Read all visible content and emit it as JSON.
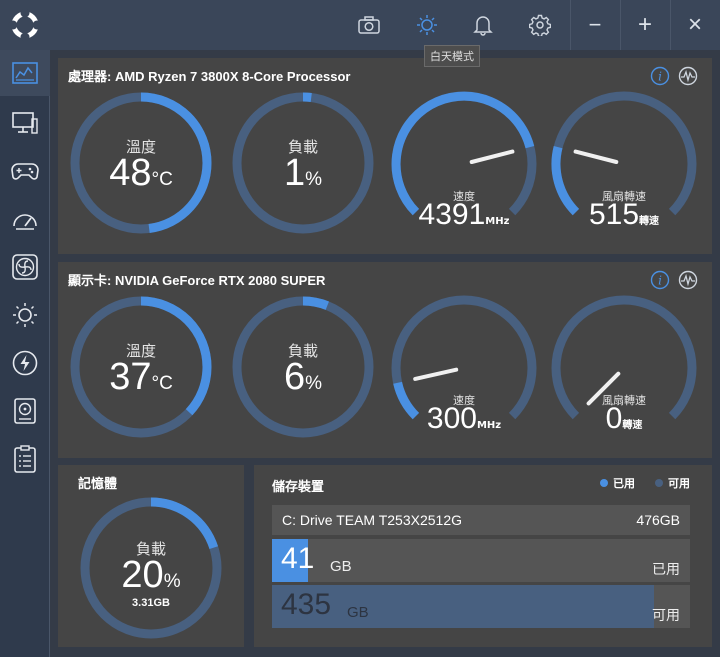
{
  "colors": {
    "accent": "#4a90e2",
    "track": "#486080",
    "panel": "#454545",
    "bg": "#343b47"
  },
  "titlebar": {
    "icons": [
      "camera-icon",
      "sun-icon",
      "bell-icon",
      "gear-icon"
    ],
    "tooltip": "白天模式",
    "minimize": "−",
    "maximize": "+",
    "close": "×"
  },
  "sidebar": {
    "items": [
      "dashboard-icon",
      "monitor-icon",
      "gamepad-icon",
      "speedometer-icon",
      "fan-icon",
      "brightness-icon",
      "lightning-icon",
      "storage-icon",
      "clipboard-icon"
    ]
  },
  "cpu": {
    "title": "處理器: AMD Ryzen 7 3800X 8-Core Processor",
    "temp": {
      "label": "溫度",
      "value": "48",
      "unit": "°C",
      "fraction": 0.48
    },
    "load": {
      "label": "負載",
      "value": "1",
      "unit": "%",
      "fraction": 0.01
    },
    "speed": {
      "label": "速度",
      "value": "4391",
      "unit": "MHz",
      "fraction": 0.78
    },
    "fan": {
      "label": "風扇轉速",
      "value": "515",
      "unit": "轉速",
      "fraction": 0.22
    }
  },
  "gpu": {
    "title": "顯示卡: NVIDIA GeForce RTX 2080 SUPER",
    "temp": {
      "label": "溫度",
      "value": "37",
      "unit": "°C",
      "fraction": 0.37
    },
    "load": {
      "label": "負載",
      "value": "6",
      "unit": "%",
      "fraction": 0.06
    },
    "speed": {
      "label": "速度",
      "value": "300",
      "unit": "MHz",
      "fraction": 0.12
    },
    "fan": {
      "label": "風扇轉速",
      "value": "0",
      "unit": "轉速",
      "fraction": 0.0
    }
  },
  "memory": {
    "title": "記憶體",
    "load": {
      "label": "負載",
      "value": "20",
      "unit": "%",
      "sub": "3.31GB",
      "fraction": 0.2
    }
  },
  "storage": {
    "title": "儲存裝置",
    "legend_used": "已用",
    "legend_free": "可用",
    "drive": {
      "name": "C: Drive TEAM T253X2512G",
      "size": "476GB"
    },
    "used": {
      "value": "41",
      "unit": "GB",
      "label": "已用",
      "fraction": 0.086
    },
    "free": {
      "value": "435",
      "unit": "GB",
      "label": "可用",
      "fraction": 0.914
    }
  }
}
